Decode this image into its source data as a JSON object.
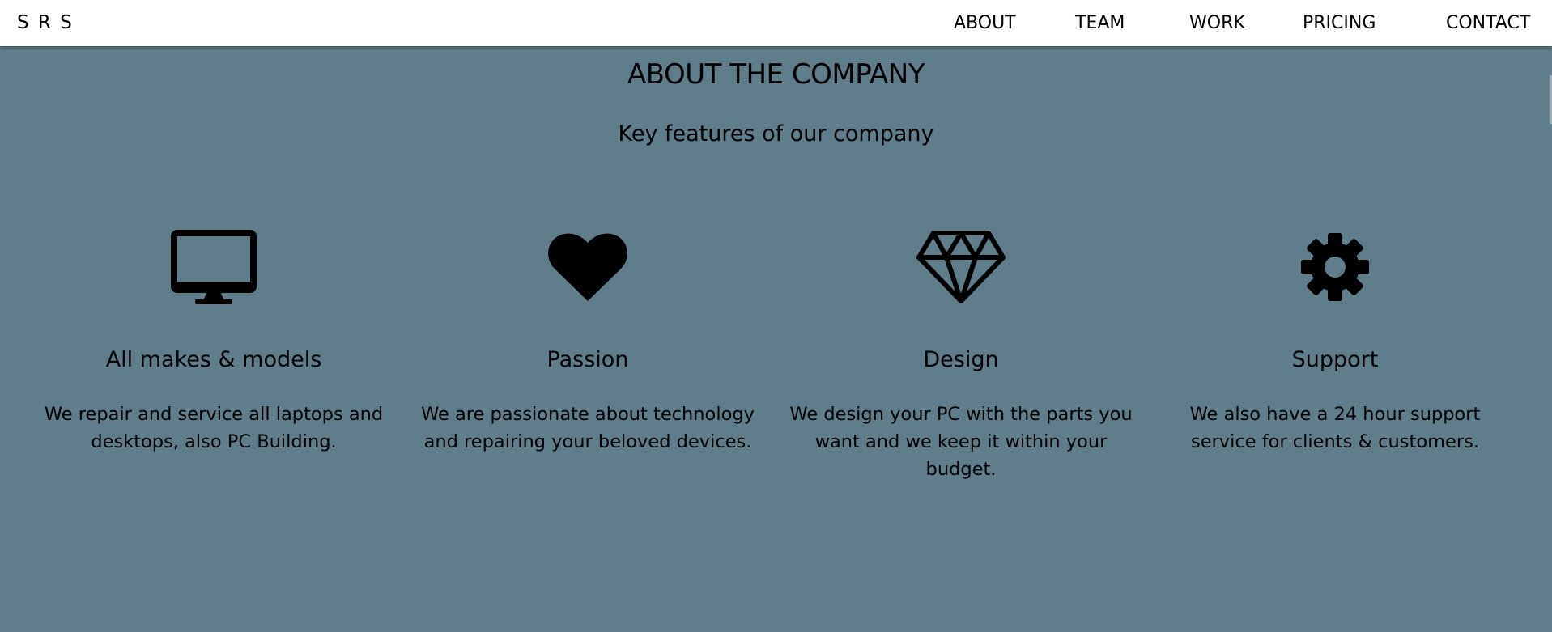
{
  "navbar": {
    "brand": "S R S",
    "links": [
      "ABOUT",
      "TEAM",
      "WORK",
      "PRICING",
      "CONTACT"
    ]
  },
  "about": {
    "title": "ABOUT THE COMPANY",
    "subtitle": "Key features of our company",
    "features": [
      {
        "icon": "desktop-icon",
        "title": "All makes & models",
        "text": "We repair and service all laptops and desktops, also PC Building."
      },
      {
        "icon": "heart-icon",
        "title": "Passion",
        "text": "We are passionate about technology and repairing your beloved devices."
      },
      {
        "icon": "diamond-icon",
        "title": "Design",
        "text": "We design your PC with the parts you want and we keep it within your budget."
      },
      {
        "icon": "gear-icon",
        "title": "Support",
        "text": "We also have a 24 hour support service for clients & customers."
      }
    ]
  },
  "colors": {
    "background": "#607d8b",
    "navbar": "#ffffff",
    "text": "#000000"
  }
}
